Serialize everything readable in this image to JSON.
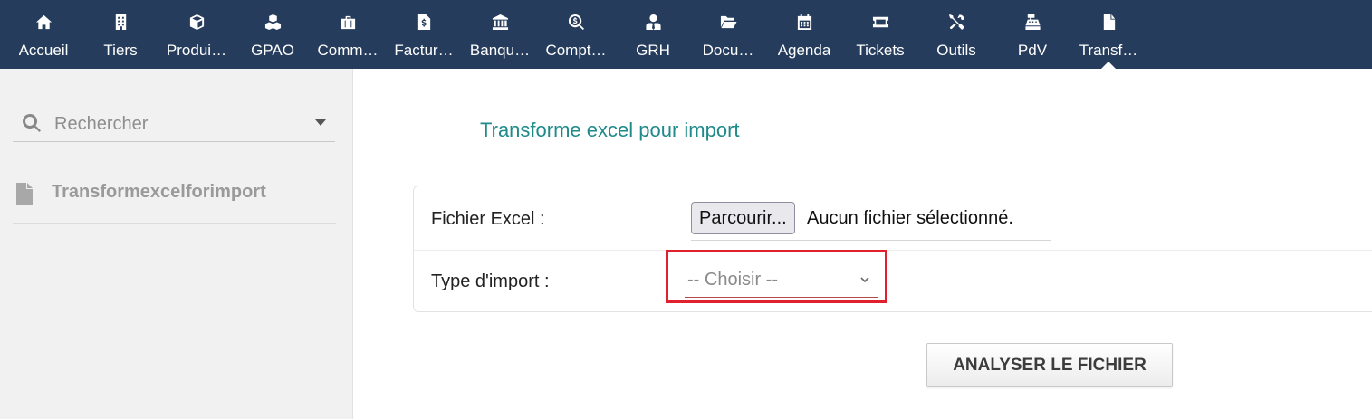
{
  "nav": {
    "items": [
      {
        "label": "Accueil",
        "icon": "home-icon"
      },
      {
        "label": "Tiers",
        "icon": "building-icon"
      },
      {
        "label": "Produi…",
        "icon": "cube-icon"
      },
      {
        "label": "GPAO",
        "icon": "cubes-icon"
      },
      {
        "label": "Comm…",
        "icon": "suitcase-icon"
      },
      {
        "label": "Factur…",
        "icon": "invoice-icon"
      },
      {
        "label": "Banqu…",
        "icon": "bank-icon"
      },
      {
        "label": "Compt…",
        "icon": "search-dollar-icon"
      },
      {
        "label": "GRH",
        "icon": "user-tie-icon"
      },
      {
        "label": "Docu…",
        "icon": "folder-open-icon"
      },
      {
        "label": "Agenda",
        "icon": "calendar-icon"
      },
      {
        "label": "Tickets",
        "icon": "ticket-icon"
      },
      {
        "label": "Outils",
        "icon": "tools-icon"
      },
      {
        "label": "PdV",
        "icon": "cash-register-icon"
      },
      {
        "label": "Transf…",
        "icon": "file-icon",
        "active": true
      }
    ]
  },
  "sidebar": {
    "search_placeholder": "Rechercher",
    "menu_item": "Transformexcelforimport"
  },
  "main": {
    "title": "Transforme excel pour import",
    "excel_label": "Fichier Excel :",
    "browse_label": "Parcourir...",
    "file_status": "Aucun fichier sélectionné.",
    "type_label": "Type d'import :",
    "type_value": "-- Choisir --",
    "analyze_label": "ANALYSER LE FICHIER"
  },
  "colors": {
    "nav_background": "#263c5c",
    "title": "#1f8a8a",
    "highlight": "#e0202c"
  }
}
